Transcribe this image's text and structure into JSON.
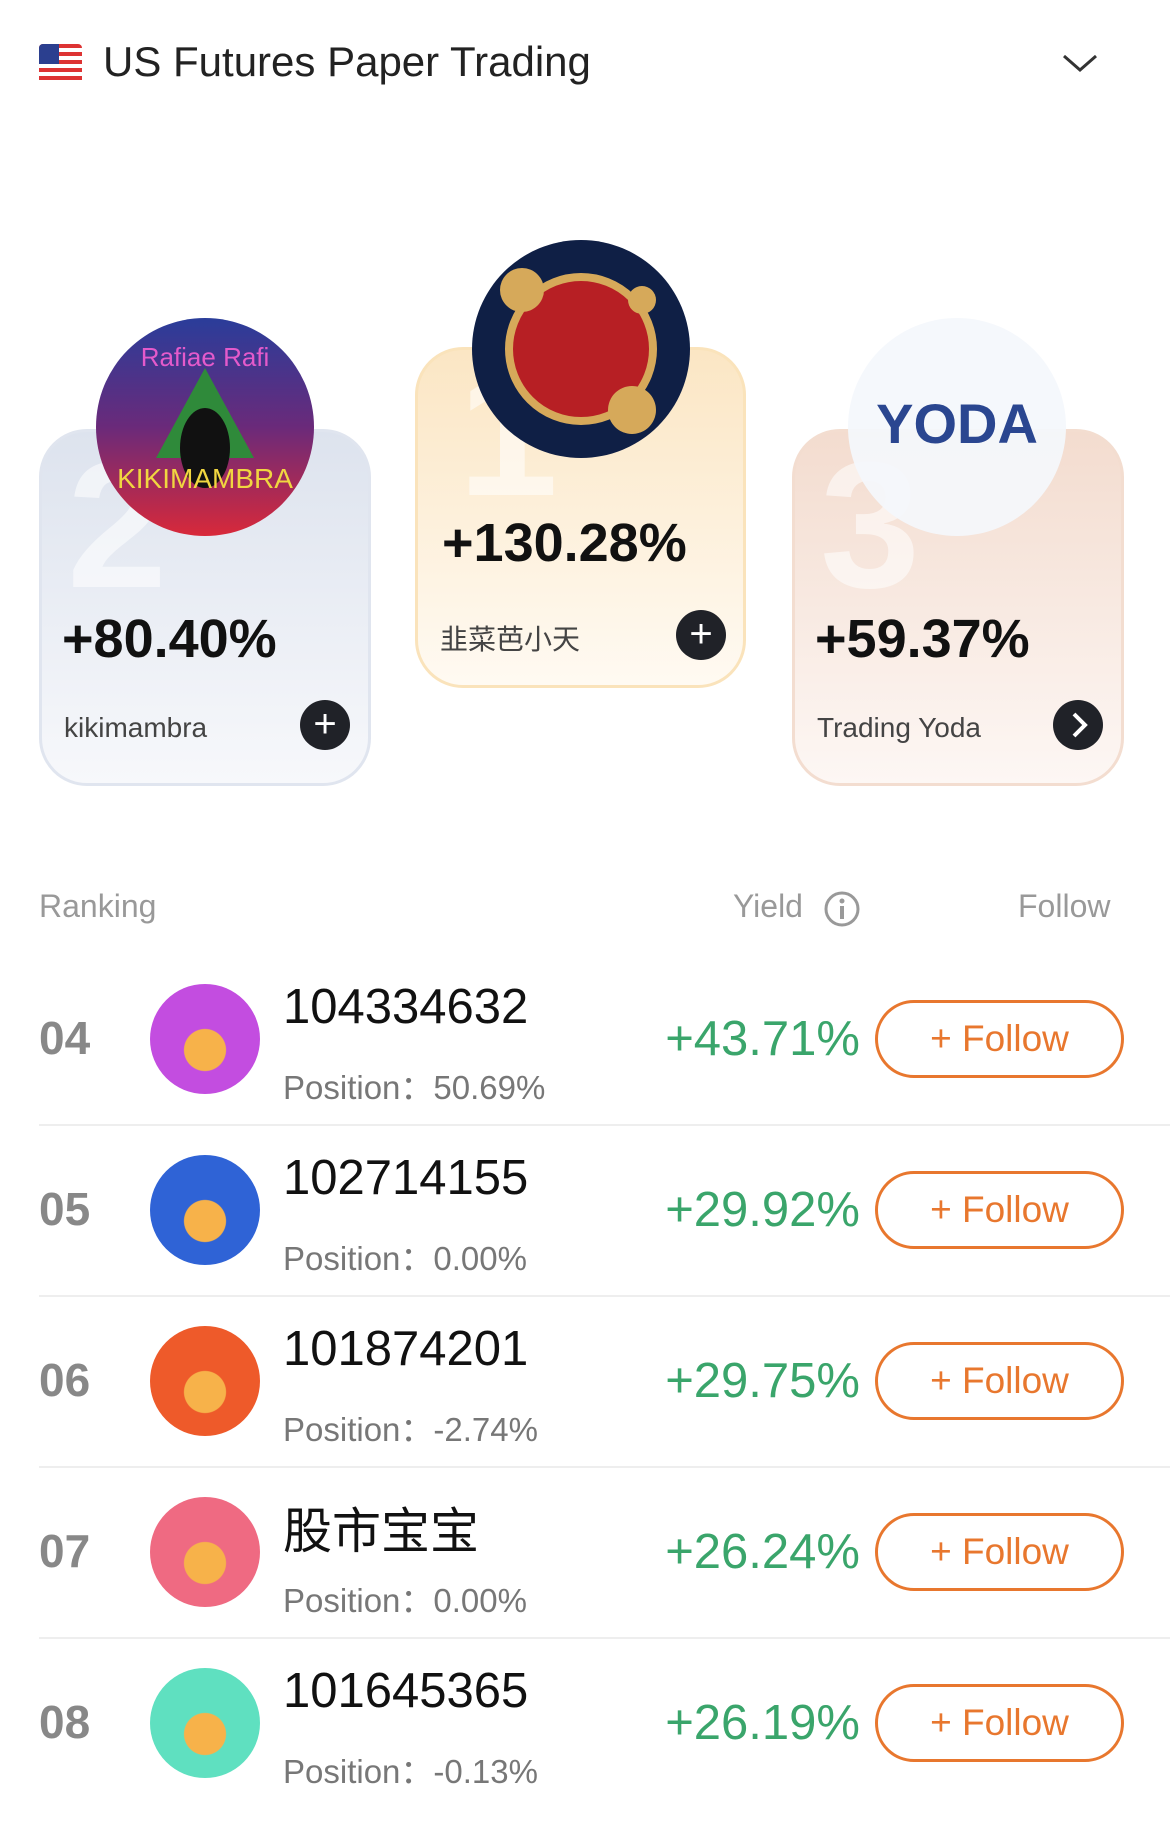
{
  "header": {
    "title": "US Futures Paper Trading",
    "flag_icon": "us-flag",
    "chevron": "chevron-down-icon"
  },
  "podium": [
    {
      "rank": "1",
      "yield": "+130.28%",
      "name": "韭菜芭小天",
      "action": "plus"
    },
    {
      "rank": "2",
      "yield": "+80.40%",
      "name": "kikimambra",
      "action": "plus",
      "avatar_text": "Rafiae Rafi"
    },
    {
      "rank": "3",
      "yield": "+59.37%",
      "name": "Trading Yoda",
      "action": "chevron-right",
      "avatar_text": "YODA"
    }
  ],
  "table": {
    "headers": {
      "ranking": "Ranking",
      "yield": "Yield",
      "follow": "Follow"
    },
    "rows": [
      {
        "rank": "04",
        "name": "104334632",
        "position": "Position：50.69%",
        "yield": "+43.71%",
        "follow": "+ Follow",
        "avatar_color": "#c34de0"
      },
      {
        "rank": "05",
        "name": "102714155",
        "position": "Position：0.00%",
        "yield": "+29.92%",
        "follow": "+ Follow",
        "avatar_color": "#2f63d6"
      },
      {
        "rank": "06",
        "name": "101874201",
        "position": "Position：-2.74%",
        "yield": "+29.75%",
        "follow": "+ Follow",
        "avatar_color": "#ee5a2a"
      },
      {
        "rank": "07",
        "name": "股市宝宝",
        "position": "Position：0.00%",
        "yield": "+26.24%",
        "follow": "+ Follow",
        "avatar_color": "#ef6a82"
      },
      {
        "rank": "08",
        "name": "101645365",
        "position": "Position：-0.13%",
        "yield": "+26.19%",
        "follow": "+ Follow",
        "avatar_color": "#5fe0c0"
      }
    ]
  },
  "colors": {
    "positive": "#3aa56b",
    "follow": "#e8772e"
  }
}
